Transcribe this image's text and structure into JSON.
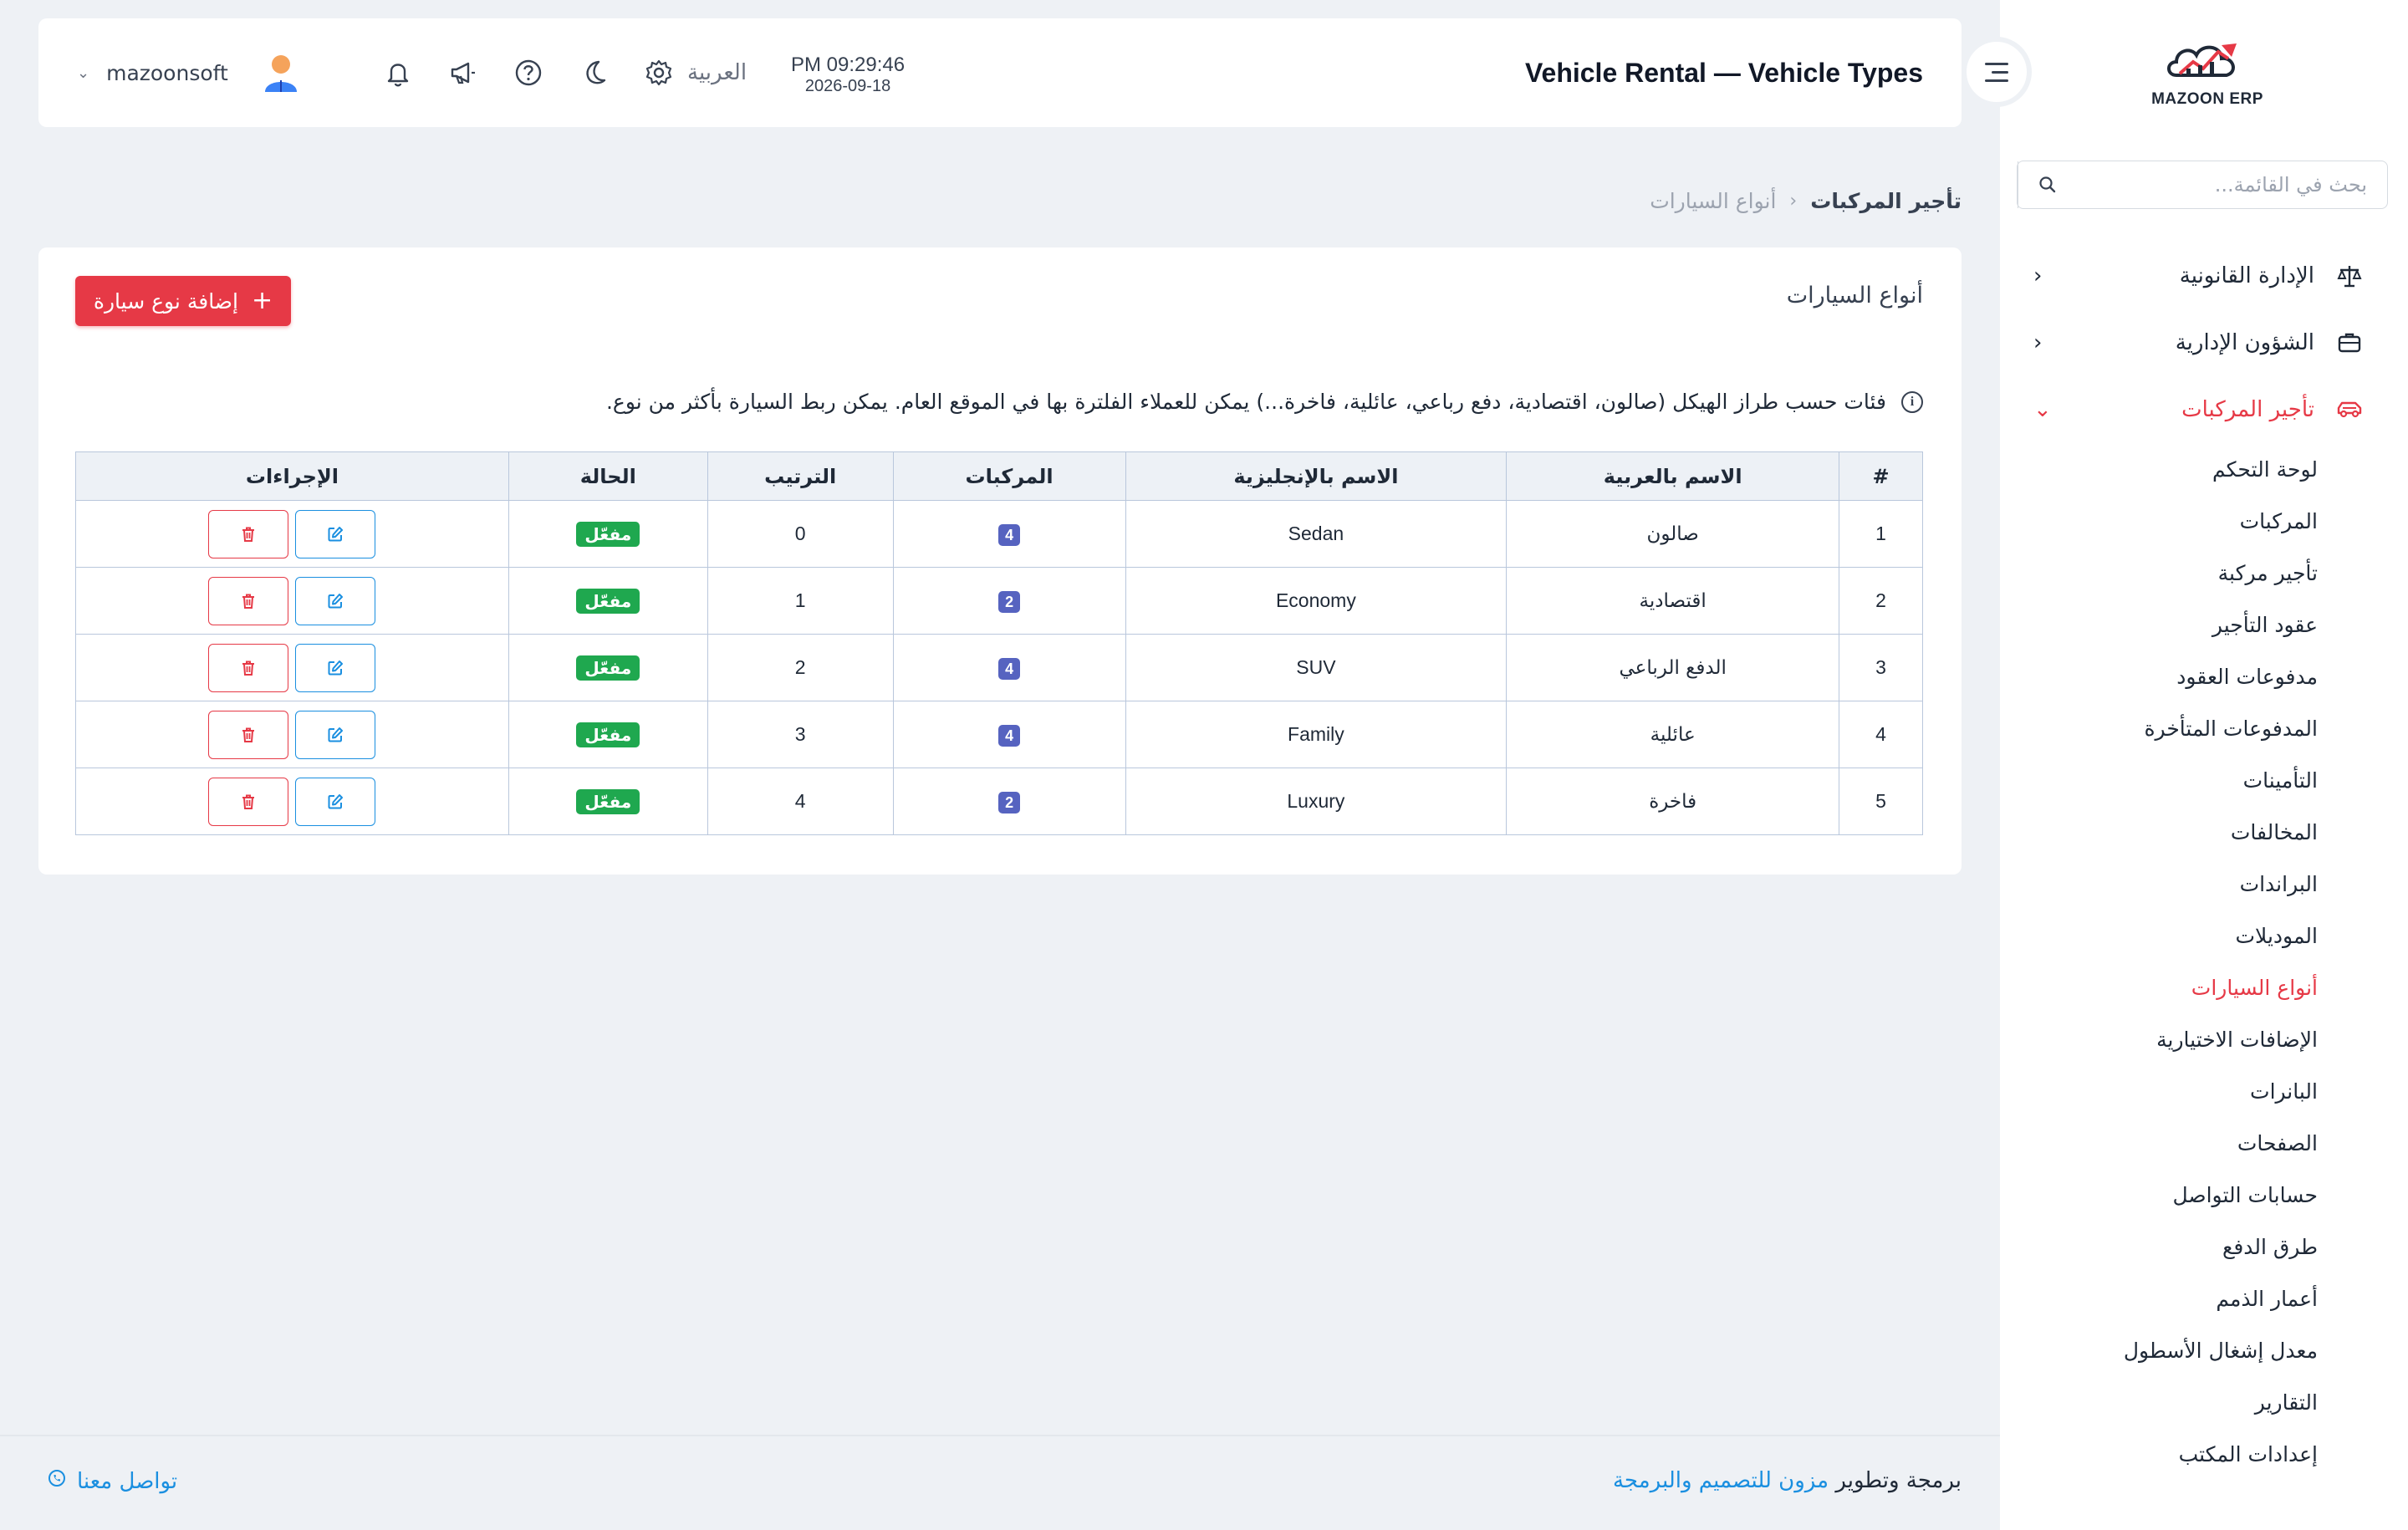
{
  "app": {
    "logo_text": "MAZOON ERP"
  },
  "sidebar": {
    "search_placeholder": "بحث في القائمة...",
    "sections": [
      {
        "label": "الإدارة القانونية",
        "icon": "scale-icon",
        "expanded": false
      },
      {
        "label": "الشؤون الإدارية",
        "icon": "briefcase-icon",
        "expanded": false
      },
      {
        "label": "تأجير المركبات",
        "icon": "car-icon",
        "expanded": true
      }
    ],
    "sub_items": [
      "لوحة التحكم",
      "المركبات",
      "تأجير مركبة",
      "عقود التأجير",
      "مدفوعات العقود",
      "المدفوعات المتأخرة",
      "التأمينات",
      "المخالفات",
      "البراندات",
      "الموديلات",
      "أنواع السيارات",
      "الإضافات الاختيارية",
      "البانرات",
      "الصفحات",
      "حسابات التواصل",
      "طرق الدفع",
      "أعمار الذمم",
      "معدل إشغال الأسطول",
      "التقارير",
      "إعدادات المكتب"
    ],
    "active_sub_item": "أنواع السيارات"
  },
  "header": {
    "title": "Vehicle Rental — Vehicle Types",
    "time": "PM 09:29:46",
    "date": "2026-09-18",
    "language": "العربية",
    "username": "mazoonsoft",
    "icons": [
      "bell-icon",
      "megaphone-icon",
      "help-icon",
      "moon-icon",
      "gear-icon"
    ]
  },
  "breadcrumb": {
    "root": "تأجير المركبات",
    "current": "أنواع السيارات"
  },
  "card": {
    "title": "أنواع السيارات",
    "add_button": "إضافة نوع سيارة",
    "info": "فئات حسب طراز الهيكل (صالون، اقتصادية، دفع رباعي، عائلية، فاخرة...) يمكن للعملاء الفلترة بها في الموقع العام. يمكن ربط السيارة بأكثر من نوع."
  },
  "table": {
    "headers": [
      "#",
      "الاسم بالعربية",
      "الاسم بالإنجليزية",
      "المركبات",
      "الترتيب",
      "الحالة",
      "الإجراءات"
    ],
    "rows": [
      {
        "num": "1",
        "name_ar": "صالون",
        "name_en": "Sedan",
        "vehicles": "4",
        "order": "0",
        "status": "مفعّل"
      },
      {
        "num": "2",
        "name_ar": "اقتصادية",
        "name_en": "Economy",
        "vehicles": "2",
        "order": "1",
        "status": "مفعّل"
      },
      {
        "num": "3",
        "name_ar": "الدفع الرباعي",
        "name_en": "SUV",
        "vehicles": "4",
        "order": "2",
        "status": "مفعّل"
      },
      {
        "num": "4",
        "name_ar": "عائلية",
        "name_en": "Family",
        "vehicles": "4",
        "order": "3",
        "status": "مفعّل"
      },
      {
        "num": "5",
        "name_ar": "فاخرة",
        "name_en": "Luxury",
        "vehicles": "2",
        "order": "4",
        "status": "مفعّل"
      }
    ]
  },
  "footer": {
    "contact": "تواصل معنا",
    "credit_prefix": "برمجة وتطوير",
    "credit_brand": "مزون للتصميم والبرمجة"
  },
  "colors": {
    "accent": "#e63946",
    "link": "#1a8fe0",
    "badge_count": "#5663c0",
    "badge_status": "#1fa84f"
  }
}
